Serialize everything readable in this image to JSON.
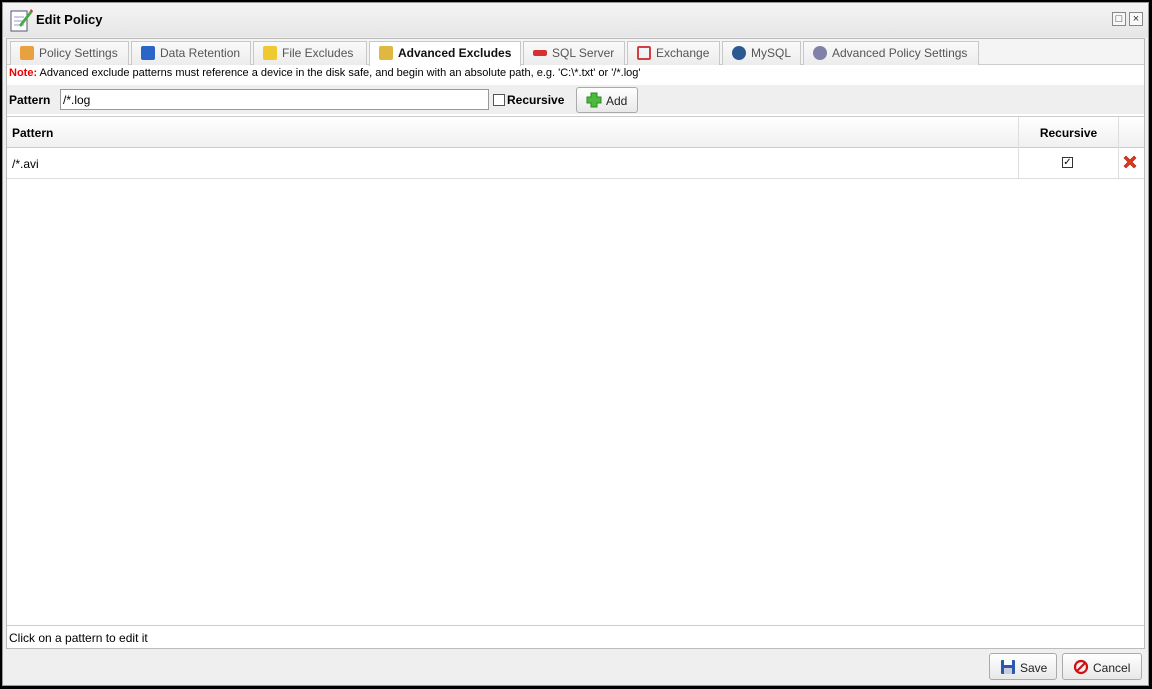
{
  "window": {
    "title": "Edit Policy",
    "icon": "notepad-pencil-icon"
  },
  "tabs": [
    {
      "label": "Policy Settings",
      "icon": "clipboard-icon",
      "color": "#e8a040"
    },
    {
      "label": "Data Retention",
      "icon": "cubes-icon",
      "color": "#2a66c8"
    },
    {
      "label": "File Excludes",
      "icon": "folder-icon",
      "color": "#f0c830"
    },
    {
      "label": "Advanced Excludes",
      "icon": "folders-icon",
      "color": "#e0b840",
      "active": true
    },
    {
      "label": "SQL Server",
      "icon": "sql-server-icon",
      "color": "#d83030"
    },
    {
      "label": "Exchange",
      "icon": "exchange-icon",
      "color": "#d04040"
    },
    {
      "label": "MySQL",
      "icon": "mysql-icon",
      "color": "#2a5a90"
    },
    {
      "label": "Advanced Policy Settings",
      "icon": "gears-icon",
      "color": "#7070a0"
    }
  ],
  "note": {
    "prefix": "Note:",
    "text": " Advanced exclude patterns must reference a device in the disk safe, and begin with an absolute path, e.g. 'C:\\*.txt' or '/*.log'"
  },
  "form": {
    "pattern_label": "Pattern",
    "pattern_value": "/*.log",
    "recursive_label": "Recursive",
    "recursive_checked": false,
    "add_label": "Add"
  },
  "grid": {
    "columns": [
      "Pattern",
      "Recursive"
    ],
    "rows": [
      {
        "pattern": "/*.avi",
        "recursive": true
      }
    ]
  },
  "status": "Click on a pattern to edit it",
  "footer": {
    "save": "Save",
    "cancel": "Cancel"
  }
}
